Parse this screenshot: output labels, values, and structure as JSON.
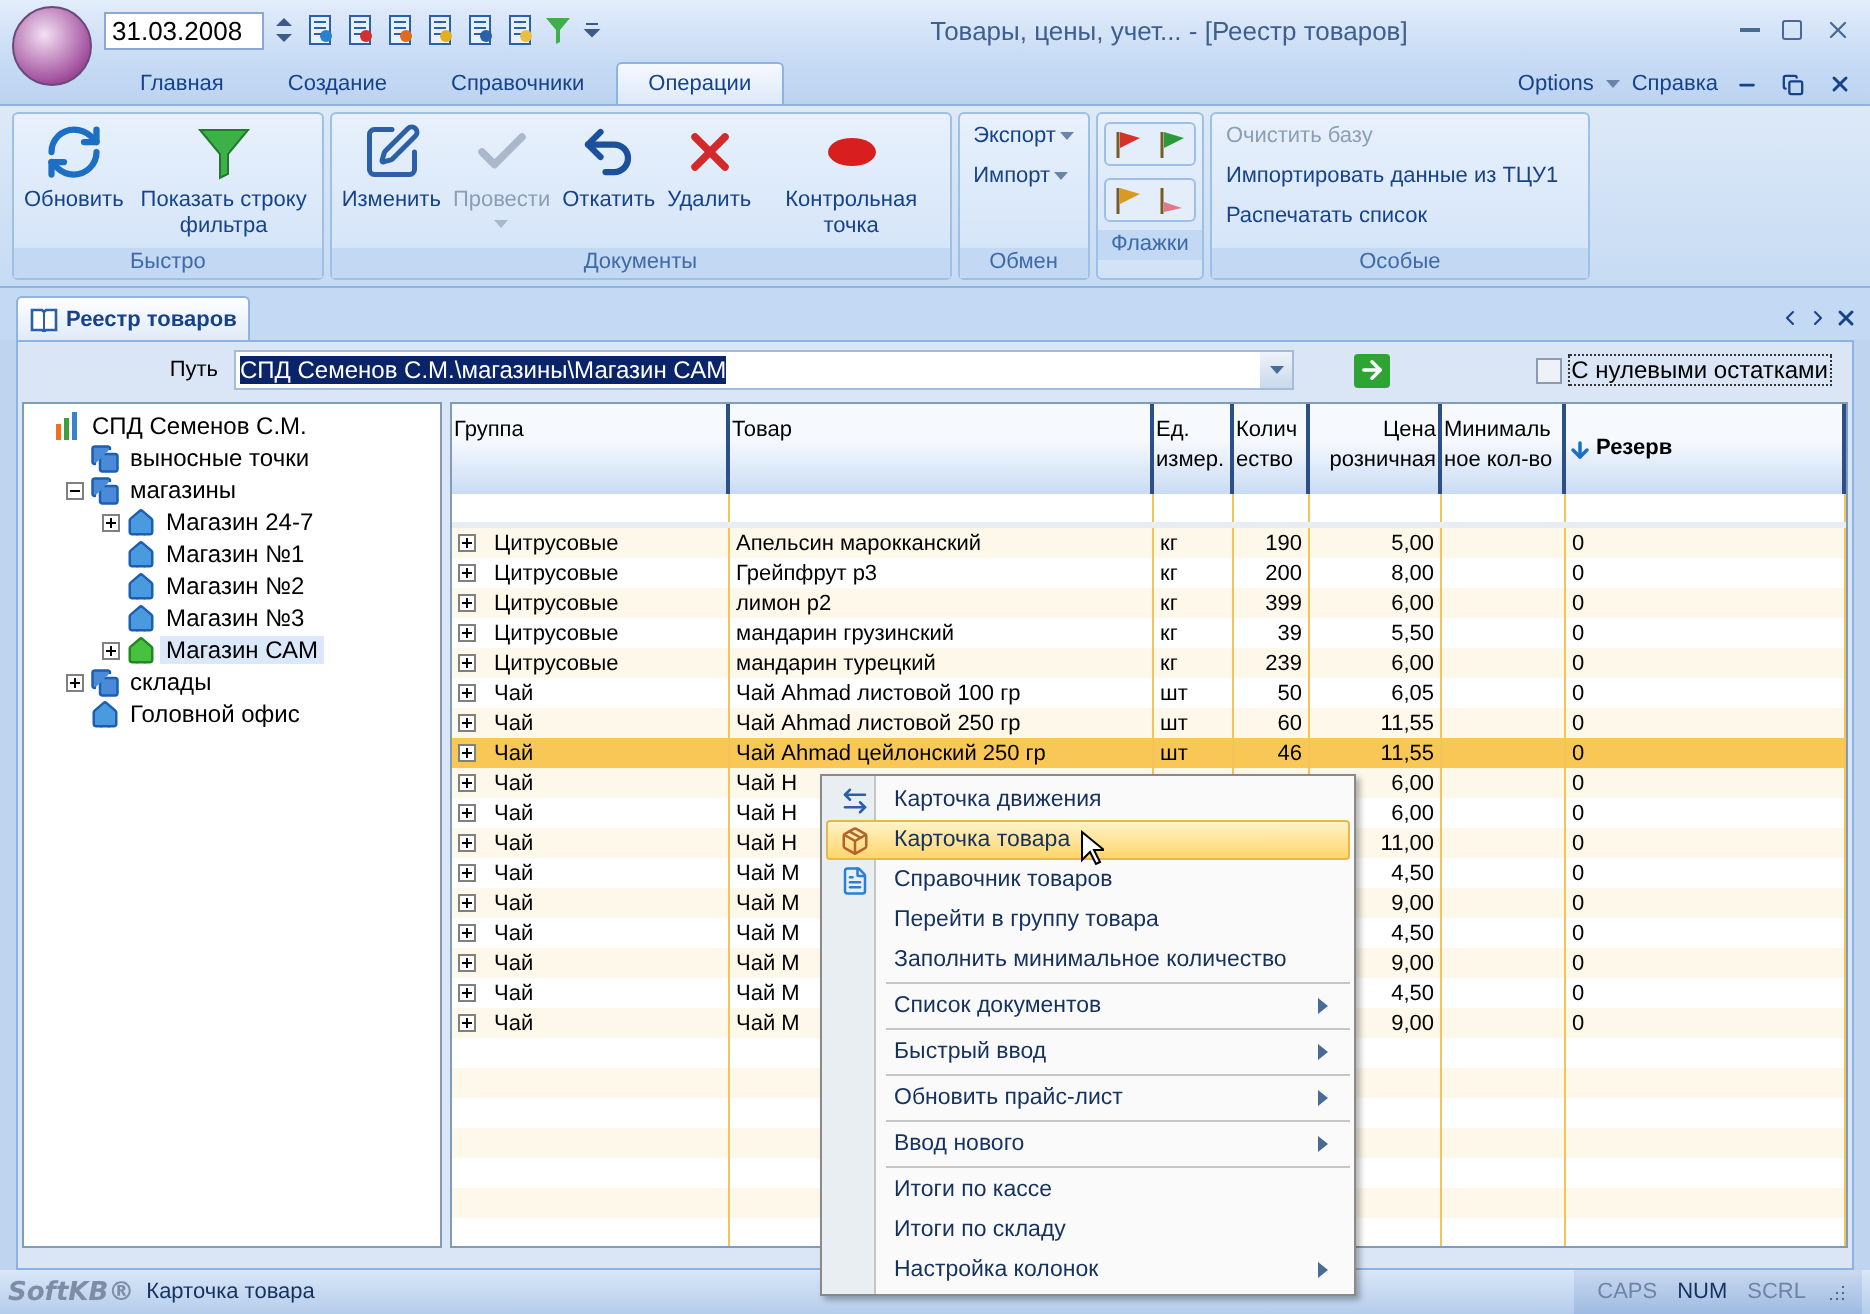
{
  "window": {
    "title": "Товары, цены, учет... - [Реестр товаров]"
  },
  "quick_access": {
    "date": "31.03.2008"
  },
  "ribbon": {
    "tabs": [
      {
        "label": "Главная",
        "selected": false
      },
      {
        "label": "Создание",
        "selected": false
      },
      {
        "label": "Справочники",
        "selected": false
      },
      {
        "label": "Операции",
        "selected": true
      }
    ],
    "options": "Options",
    "help": "Справка",
    "groups": [
      {
        "title": "Быстро",
        "kind": "large",
        "items": [
          {
            "label": "Обновить",
            "disabled": false,
            "dropdown": false
          },
          {
            "label": "Показать строку фильтра",
            "disabled": false,
            "dropdown": false
          }
        ]
      },
      {
        "title": "Документы",
        "kind": "large",
        "items": [
          {
            "label": "Изменить",
            "disabled": false,
            "dropdown": false
          },
          {
            "label": "Провести",
            "disabled": true,
            "dropdown": true
          },
          {
            "label": "Откатить",
            "disabled": false,
            "dropdown": false
          },
          {
            "label": "Удалить",
            "disabled": false,
            "dropdown": false
          },
          {
            "label": "Контрольная точка",
            "disabled": false,
            "dropdown": false
          }
        ]
      },
      {
        "title": "Обмен",
        "kind": "small",
        "items": [
          {
            "label": "Экспорт",
            "disabled": false,
            "dropdown": true
          },
          {
            "label": "Импорт",
            "disabled": false,
            "dropdown": true
          }
        ]
      },
      {
        "title": "Флажки",
        "kind": "flags",
        "items": [
          {
            "color": "#d8302a"
          },
          {
            "color": "#2a9a3a"
          },
          {
            "color": "#d89a20"
          },
          {
            "color": "#e07a8a"
          }
        ]
      },
      {
        "title": "Особые",
        "kind": "list",
        "items": [
          {
            "label": "Очистить базу",
            "disabled": true,
            "dropdown": false
          },
          {
            "label": "Импортировать данные из ТЦУ1",
            "disabled": false,
            "dropdown": false
          },
          {
            "label": "Распечатать список",
            "disabled": false,
            "dropdown": false
          }
        ]
      }
    ]
  },
  "document_tab": {
    "label": "Реестр товаров"
  },
  "path": {
    "label": "Путь",
    "value": "СПД Семенов С.М.\\магазины\\Магазин САМ"
  },
  "zero_balance": {
    "label": "С нулевыми остатками",
    "checked": false
  },
  "tree": [
    {
      "label": "СПД Семенов С.М.",
      "kind": "root",
      "selected": false,
      "children": [
        {
          "label": "выносные точки",
          "kind": "group",
          "selected": false
        },
        {
          "label": "магазины",
          "kind": "group",
          "selected": false,
          "expanded": true,
          "children": [
            {
              "label": "Магазин 24-7",
              "kind": "shop",
              "selected": false,
              "expanded": false
            },
            {
              "label": "Магазин №1",
              "kind": "shop",
              "selected": false
            },
            {
              "label": "Магазин №2",
              "kind": "shop",
              "selected": false
            },
            {
              "label": "Магазин №3",
              "kind": "shop",
              "selected": false
            },
            {
              "label": "Магазин САМ",
              "kind": "shop",
              "selected": true,
              "expanded": false
            }
          ]
        },
        {
          "label": "склады",
          "kind": "group",
          "selected": false,
          "expanded": false
        },
        {
          "label": "Головной офис",
          "kind": "shop",
          "selected": false
        }
      ]
    }
  ],
  "table": {
    "columns": [
      {
        "label": "Группа"
      },
      {
        "label": "Товар"
      },
      {
        "label": "Ед. измер."
      },
      {
        "label": "Количество"
      },
      {
        "label": "Цена розничная"
      },
      {
        "label": "Минимальное кол-во"
      },
      {
        "label": "Резерв",
        "sorted": true
      }
    ],
    "rows": [
      {
        "group": "Цитрусовые",
        "product": "Апельсин марокканский",
        "unit": "кг",
        "quantity": "190",
        "price": "5,00",
        "reserve": "0",
        "selected": false
      },
      {
        "group": "Цитрусовые",
        "product": "Грейпфрут р3",
        "unit": "кг",
        "quantity": "200",
        "price": "8,00",
        "reserve": "0",
        "selected": false
      },
      {
        "group": "Цитрусовые",
        "product": "лимон р2",
        "unit": "кг",
        "quantity": "399",
        "price": "6,00",
        "reserve": "0",
        "selected": false
      },
      {
        "group": "Цитрусовые",
        "product": "мандарин грузинский",
        "unit": "кг",
        "quantity": "39",
        "price": "5,50",
        "reserve": "0",
        "selected": false
      },
      {
        "group": "Цитрусовые",
        "product": "мандарин турецкий",
        "unit": "кг",
        "quantity": "239",
        "price": "6,00",
        "reserve": "0",
        "selected": false
      },
      {
        "group": "Чай",
        "product": "Чай Ahmad листовой 100 гр",
        "unit": "шт",
        "quantity": "50",
        "price": "6,05",
        "reserve": "0",
        "selected": false
      },
      {
        "group": "Чай",
        "product": "Чай Ahmad листовой 250 гр",
        "unit": "шт",
        "quantity": "60",
        "price": "11,55",
        "reserve": "0",
        "selected": false
      },
      {
        "group": "Чай",
        "product": "Чай Ahmad цейлонский 250 гр",
        "unit": "шт",
        "quantity": "46",
        "price": "11,55",
        "reserve": "0",
        "selected": true
      },
      {
        "group": "Чай",
        "product": "Чай Н",
        "price": "6,00",
        "reserve": "0",
        "selected": false
      },
      {
        "group": "Чай",
        "product": "Чай Н",
        "price": "6,00",
        "reserve": "0",
        "selected": false
      },
      {
        "group": "Чай",
        "product": "Чай Н",
        "price": "11,00",
        "reserve": "0",
        "selected": false
      },
      {
        "group": "Чай",
        "product": "Чай М",
        "price": "4,50",
        "reserve": "0",
        "selected": false
      },
      {
        "group": "Чай",
        "product": "Чай М",
        "price": "9,00",
        "reserve": "0",
        "selected": false
      },
      {
        "group": "Чай",
        "product": "Чай М",
        "price": "4,50",
        "reserve": "0",
        "selected": false
      },
      {
        "group": "Чай",
        "product": "Чай М",
        "price": "9,00",
        "reserve": "0",
        "selected": false
      },
      {
        "group": "Чай",
        "product": "Чай М",
        "price": "4,50",
        "reserve": "0",
        "selected": false
      },
      {
        "group": "Чай",
        "product": "Чай М",
        "price": "9,00",
        "reserve": "0",
        "selected": false
      }
    ]
  },
  "context_menu": {
    "items": [
      {
        "label": "Карточка движения",
        "selected": false,
        "submenu": false,
        "separator_before": false
      },
      {
        "label": "Карточка товара",
        "selected": true,
        "submenu": false,
        "separator_before": false
      },
      {
        "label": "Справочник товаров",
        "selected": false,
        "submenu": false,
        "separator_before": false
      },
      {
        "label": "Перейти в группу товара",
        "selected": false,
        "submenu": false,
        "separator_before": false
      },
      {
        "label": "Заполнить минимальное количество",
        "selected": false,
        "submenu": false,
        "separator_before": false
      },
      {
        "label": "Список документов",
        "selected": false,
        "submenu": true,
        "separator_before": true
      },
      {
        "label": "Быстрый ввод",
        "selected": false,
        "submenu": true,
        "separator_before": true
      },
      {
        "label": "Обновить прайс-лист",
        "selected": false,
        "submenu": true,
        "separator_before": true
      },
      {
        "label": "Ввод нового",
        "selected": false,
        "submenu": true,
        "separator_before": true
      },
      {
        "label": "Итоги по кассе",
        "selected": false,
        "submenu": false,
        "separator_before": true
      },
      {
        "label": "Итоги по складу",
        "selected": false,
        "submenu": false,
        "separator_before": false
      },
      {
        "label": "Настройка колонок",
        "selected": false,
        "submenu": true,
        "separator_before": false
      }
    ]
  },
  "status_bar": {
    "logo": "SoftKB®",
    "text": "Карточка товара",
    "indicators": [
      {
        "label": "CAPS",
        "on": false
      },
      {
        "label": "NUM",
        "on": true
      },
      {
        "label": "SCRL",
        "on": false
      }
    ]
  }
}
